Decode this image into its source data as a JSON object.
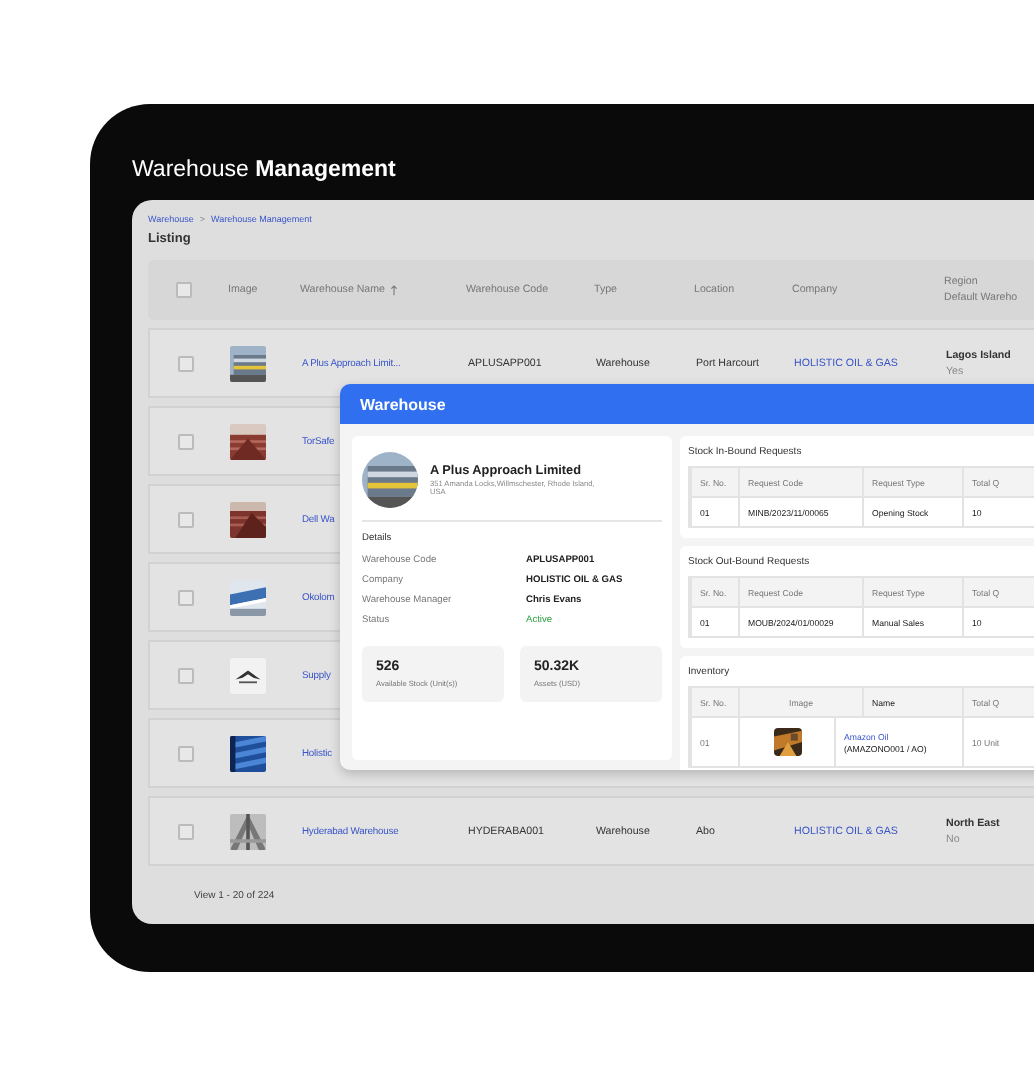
{
  "device_title": "Warehouse **Management**",
  "breadcrumb": [
    {
      "label": "Warehouse"
    },
    {
      "label": "Warehouse Management"
    }
  ],
  "breadcrumb_separator": ">",
  "page_title": "Listing",
  "table": {
    "columns": [
      {
        "label": "Image"
      },
      {
        "label": "Warehouse Name",
        "sortable": true
      },
      {
        "label": "Warehouse Code"
      },
      {
        "label": "Type"
      },
      {
        "label": "Location"
      },
      {
        "label": "Company"
      },
      {
        "label": "Region",
        "sub": "Default Wareho"
      }
    ],
    "all_checked": false,
    "rows": [
      {
        "checked": false,
        "name": "A Plus Approach Limit...",
        "code": "APLUSAPP001",
        "type": "Warehouse",
        "location": "Port Harcourt",
        "company": "HOLISTIC OIL & GAS",
        "region": "Lagos Island",
        "default": "Yes"
      },
      {
        "checked": false,
        "name": "TorSafe"
      },
      {
        "checked": false,
        "name": "Dell Wa"
      },
      {
        "checked": false,
        "name": "Okolom"
      },
      {
        "checked": false,
        "name": "Supply"
      },
      {
        "checked": false,
        "name": "Holistic"
      },
      {
        "checked": false,
        "name": "Hyderabad Warehouse",
        "code": "HYDERABA001",
        "type": "Warehouse",
        "location": "Abo",
        "company": "HOLISTIC OIL & GAS",
        "region": "North East",
        "default": "No"
      }
    ]
  },
  "footer": "View 1 - 20 of 224",
  "modal": {
    "title": "Warehouse",
    "name": "A Plus Approach Limited",
    "address": "351 Amanda Locks,Willmschester, Rhode Island, USA",
    "details_title": "Details",
    "details": [
      {
        "label": "Warehouse Code",
        "value": "APLUSAPP001"
      },
      {
        "label": "Company",
        "value": "HOLISTIC OIL & GAS"
      },
      {
        "label": "Warehouse Manager",
        "value": "Chris Evans"
      },
      {
        "label": "Status",
        "value": "Active",
        "kind": "status"
      }
    ],
    "stats": [
      {
        "value": "526",
        "label": "Available Stock (Unit(s))"
      },
      {
        "value": "50.32K",
        "label": "Assets (USD)"
      }
    ],
    "inbound": {
      "title": "Stock In-Bound Requests",
      "columns": [
        "Sr. No.",
        "Request Code",
        "Request Type",
        "Total Q"
      ],
      "rows": [
        [
          "01",
          "MINB/2023/11/00065",
          "Opening Stock",
          "10"
        ]
      ]
    },
    "outbound": {
      "title": "Stock Out-Bound Requests",
      "columns": [
        "Sr. No.",
        "Request Code",
        "Request Type",
        "Total Q"
      ],
      "rows": [
        [
          "01",
          "MOUB/2024/01/00029",
          "Manual Sales",
          "10"
        ]
      ]
    },
    "inventory": {
      "title": "Inventory",
      "columns": [
        "Sr. No.",
        "Image",
        "Name",
        "Total Q"
      ],
      "rows": [
        {
          "no": "01",
          "name": "Amazon Oil",
          "code": "(AMAZONO001 / AO)",
          "total": "10 Unit"
        }
      ]
    }
  }
}
